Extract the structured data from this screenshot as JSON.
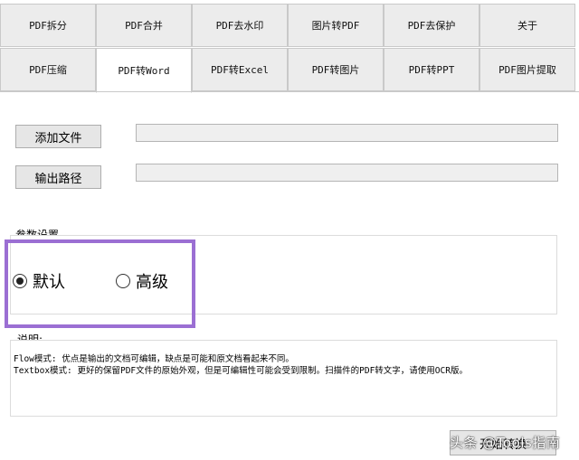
{
  "tabs_row1": [
    "PDF拆分",
    "PDF合并",
    "PDF去水印",
    "图片转PDF",
    "PDF去保护",
    "关于"
  ],
  "tabs_row2": [
    "PDF压缩",
    "PDF转Word",
    "PDF转Excel",
    "PDF转图片",
    "PDF转PPT",
    "PDF图片提取"
  ],
  "active_tab": "PDF转Word",
  "inputs": {
    "add_file_button": "添加文件",
    "add_file_value": "",
    "output_path_button": "输出路径",
    "output_path_value": ""
  },
  "params": {
    "group_label": "参数设置",
    "option_default": "默认",
    "option_advanced": "高级",
    "selected": "默认"
  },
  "description": {
    "label": "说明:",
    "line1": "Flow模式: 优点是输出的文档可编辑，缺点是可能和原文档看起来不同。",
    "line2": "Textbox模式: 更好的保留PDF文件的原始外观，但是可编辑性可能会受到限制。扫描件的PDF转文字，请使用OCR版。"
  },
  "start_button": "开始转换",
  "watermark": "头条 @Tools指南"
}
